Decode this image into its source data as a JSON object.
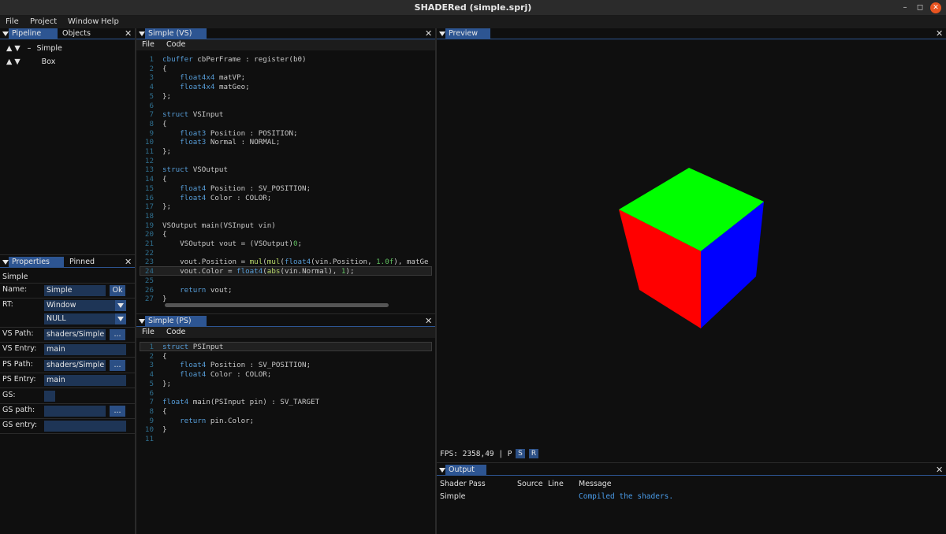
{
  "window": {
    "title": "SHADERed (simple.sprj)",
    "min_glyph": "–",
    "max_glyph": "◻",
    "close_glyph": "✕"
  },
  "menu": [
    "File",
    "Project",
    "Window",
    "Help"
  ],
  "left_top": {
    "tabs": [
      "Pipeline",
      "Objects"
    ],
    "close": "✕",
    "tree": [
      {
        "arrows": "▲ ▼",
        "prefix": "–",
        "label": "Simple"
      },
      {
        "arrows": "▲ ▼",
        "prefix": "",
        "label": "Box"
      }
    ]
  },
  "properties": {
    "tabs": [
      "Properties",
      "Pinned"
    ],
    "close": "✕",
    "header": "Simple",
    "name_label": "Name:",
    "name_value": "Simple",
    "ok_label": "Ok",
    "rt_label": "RT:",
    "rt_values": [
      "Window",
      "NULL"
    ],
    "vs_path_label": "VS Path:",
    "vs_path_value": "shaders/Simple",
    "browse_label": "...",
    "vs_entry_label": "VS Entry:",
    "vs_entry_value": "main",
    "ps_path_label": "PS Path:",
    "ps_path_value": "shaders/Simple",
    "ps_entry_label": "PS Entry:",
    "ps_entry_value": "main",
    "gs_label": "GS:",
    "gs_path_label": "GS path:",
    "gs_path_value": "",
    "gs_entry_label": "GS entry:",
    "gs_entry_value": ""
  },
  "vs_editor": {
    "tab": "Simple (VS)",
    "close": "✕",
    "menu": [
      "File",
      "Code"
    ],
    "lines": [
      {
        "n": "1",
        "t": "cbuffer cbPerFrame : register(b0)"
      },
      {
        "n": "2",
        "t": "{"
      },
      {
        "n": "3",
        "t": "    float4x4 matVP;"
      },
      {
        "n": "4",
        "t": "    float4x4 matGeo;"
      },
      {
        "n": "5",
        "t": "};"
      },
      {
        "n": "6",
        "t": ""
      },
      {
        "n": "7",
        "t": "struct VSInput"
      },
      {
        "n": "8",
        "t": "{"
      },
      {
        "n": "9",
        "t": "    float3 Position : POSITION;"
      },
      {
        "n": "10",
        "t": "    float3 Normal : NORMAL;"
      },
      {
        "n": "11",
        "t": "};"
      },
      {
        "n": "12",
        "t": ""
      },
      {
        "n": "13",
        "t": "struct VSOutput"
      },
      {
        "n": "14",
        "t": "{"
      },
      {
        "n": "15",
        "t": "    float4 Position : SV_POSITION;"
      },
      {
        "n": "16",
        "t": "    float4 Color : COLOR;"
      },
      {
        "n": "17",
        "t": "};"
      },
      {
        "n": "18",
        "t": ""
      },
      {
        "n": "19",
        "t": "VSOutput main(VSInput vin)"
      },
      {
        "n": "20",
        "t": "{"
      },
      {
        "n": "21",
        "t": "    VSOutput vout = (VSOutput)0;"
      },
      {
        "n": "22",
        "t": ""
      },
      {
        "n": "23",
        "t": "    vout.Position = mul(mul(float4(vin.Position, 1.0f), matGe"
      },
      {
        "n": "24",
        "t": "    vout.Color = float4(abs(vin.Normal), 1);"
      },
      {
        "n": "25",
        "t": ""
      },
      {
        "n": "26",
        "t": "    return vout;"
      },
      {
        "n": "27",
        "t": "}"
      }
    ],
    "highlight_line": "24"
  },
  "ps_editor": {
    "tab": "Simple (PS)",
    "close": "✕",
    "menu": [
      "File",
      "Code"
    ],
    "lines": [
      {
        "n": "1",
        "t": "struct PSInput"
      },
      {
        "n": "2",
        "t": "{"
      },
      {
        "n": "3",
        "t": "    float4 Position : SV_POSITION;"
      },
      {
        "n": "4",
        "t": "    float4 Color : COLOR;"
      },
      {
        "n": "5",
        "t": "};"
      },
      {
        "n": "6",
        "t": ""
      },
      {
        "n": "7",
        "t": "float4 main(PSInput pin) : SV_TARGET"
      },
      {
        "n": "8",
        "t": "{"
      },
      {
        "n": "9",
        "t": "    return pin.Color;"
      },
      {
        "n": "10",
        "t": "}"
      },
      {
        "n": "11",
        "t": ""
      }
    ],
    "highlight_line": "1"
  },
  "preview": {
    "tab": "Preview",
    "close": "✕",
    "fps_text": "FPS: 2358,49  |  P",
    "s_label": "S",
    "r_label": "R",
    "cube_colors": {
      "top": "#00ff00",
      "left": "#ff0000",
      "right": "#0000ff"
    }
  },
  "output": {
    "tab": "Output",
    "close": "✕",
    "headers": [
      "Shader Pass",
      "Source",
      "Line",
      "Message"
    ],
    "rows": [
      {
        "pass": "Simple",
        "source": "",
        "line": "",
        "message": "Compiled the shaders."
      }
    ],
    "message_color": "#4a9be8"
  },
  "keywords": [
    "cbuffer",
    "struct",
    "float4x4",
    "float4",
    "float3",
    "return"
  ],
  "functions": [
    "mul",
    "abs"
  ]
}
